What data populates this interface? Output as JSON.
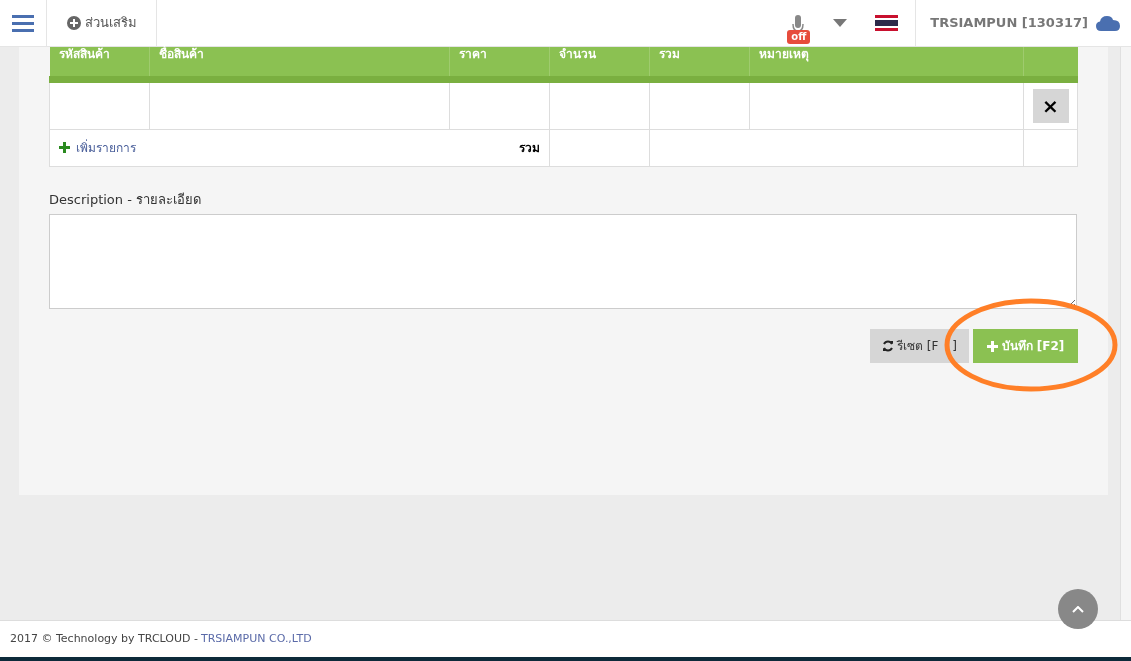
{
  "navbar": {
    "addons_label": "ส่วนเสริม",
    "mic_badge": "off",
    "user": "TRSIAMPUN [130317]"
  },
  "table": {
    "columns": [
      "รหัสสินค้า",
      "ชื่อสินค้า",
      "ราคา",
      "จำนวน",
      "รวม",
      "หมายเหตุ"
    ],
    "remove_button": "×",
    "add_item": "เพิ่มรายการ",
    "total_label": "รวม"
  },
  "description": {
    "label": "Description - รายละเอียด"
  },
  "buttons": [
    {
      "kind": "reset",
      "label": "รีเซต [F",
      "label_end": "]"
    },
    {
      "kind": "save",
      "label": "บันทึก [F2]"
    }
  ],
  "annotation": {
    "kind": "ellipse"
  },
  "footer": {
    "text": "2017 © Technology by TRCLOUD - ",
    "link": "TRSIAMPUN CO.,LTD"
  }
}
